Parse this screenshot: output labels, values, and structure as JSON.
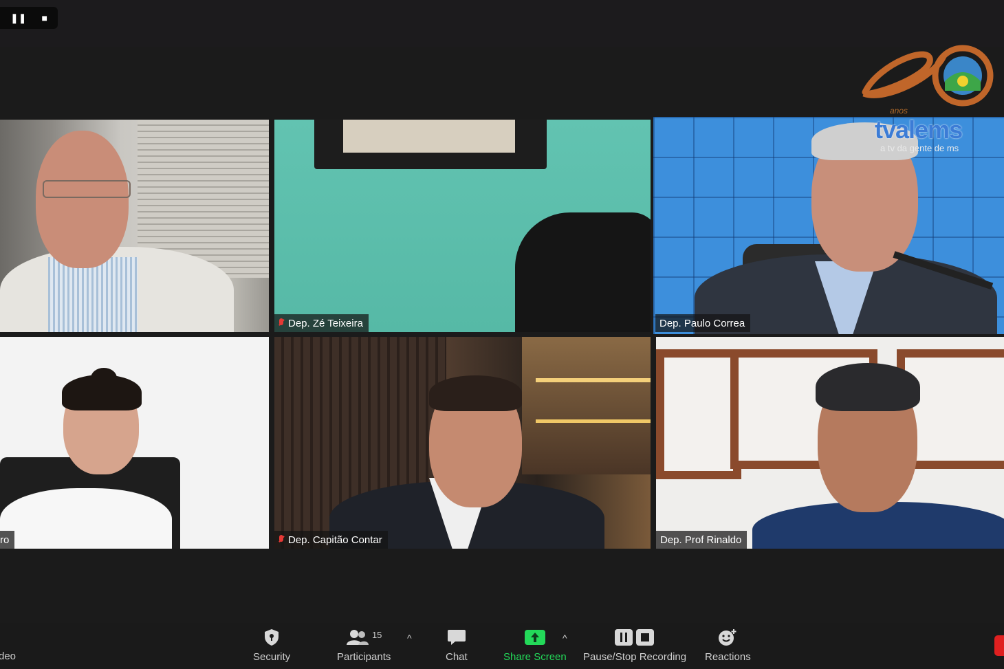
{
  "recording_controls": {
    "pause_icon": "pause-icon",
    "stop_icon": "stop-icon"
  },
  "tiles": [
    {
      "name": "",
      "muted": false
    },
    {
      "name": "Dep. Zé Teixeira",
      "muted": true
    },
    {
      "name": "Dep. Paulo Correa",
      "muted": false,
      "active_speaker": true
    },
    {
      "name": "ro",
      "muted": false
    },
    {
      "name": "Dep. Capitão Contar",
      "muted": true
    },
    {
      "name": "Dep. Prof Rinaldo",
      "muted": false
    }
  ],
  "watermark": {
    "brand": "tvalems",
    "tagline": "a tv da gente de ms",
    "anos": "anos"
  },
  "toolbar": {
    "video_label": "deo",
    "security_label": "Security",
    "participants_label": "Participants",
    "participants_count": "15",
    "chat_label": "Chat",
    "share_label": "Share Screen",
    "recording_label": "Pause/Stop Recording",
    "reactions_label": "Reactions"
  },
  "colors": {
    "active_speaker": "#c5e232",
    "share_green": "#23d959",
    "end_red": "#e02020",
    "muted_mic": "#e53935"
  }
}
